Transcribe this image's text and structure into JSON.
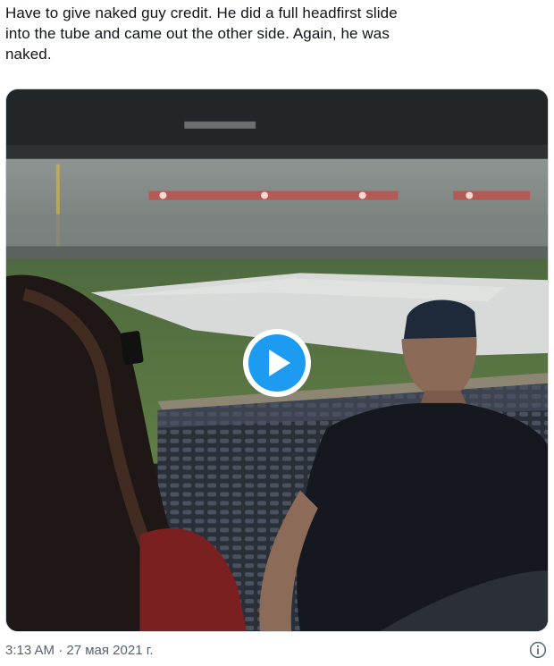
{
  "tweet": {
    "text": "Have to give naked guy credit. He did a full headfirst slide\ninto the tube and came out the other side. Again, he was\nnaked.",
    "timestamp": "3:13 AM · 27 мая 2021 г."
  },
  "media": {
    "type": "video",
    "play_icon": "play-icon",
    "accent_color": "#1d9bf0"
  },
  "icons": {
    "info": "info-icon"
  }
}
